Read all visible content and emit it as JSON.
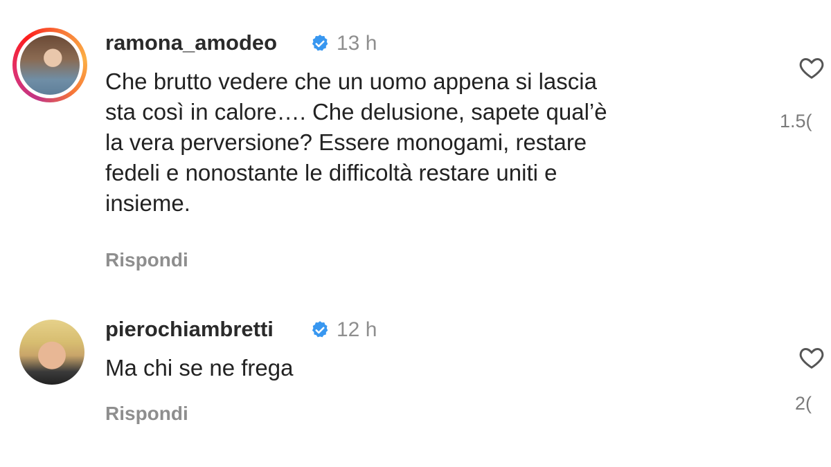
{
  "comments": [
    {
      "username": "ramona_amodeo",
      "verified": true,
      "time": "13 h",
      "text_lines": [
        "Che brutto vedere che un uomo appena si lascia",
        "sta così in calore…. Che delusione, sapete qual’è",
        "la vera perversione? Essere monogami, restare",
        "fedeli e nonostante le difficoltà restare uniti e",
        "insieme."
      ],
      "reply_label": "Rispondi",
      "likes": "1.5(",
      "has_story_ring": true
    },
    {
      "username": "pierochiambretti",
      "verified": true,
      "time": "12 h",
      "text_lines": [
        "Ma chi se ne frega"
      ],
      "reply_label": "Rispondi",
      "likes": "2(",
      "has_story_ring": false
    }
  ],
  "icons": {
    "verified": "verified-badge-icon",
    "like": "heart-icon"
  },
  "colors": {
    "verified_blue": "#3897f0",
    "muted_text": "#8e8e8e"
  }
}
